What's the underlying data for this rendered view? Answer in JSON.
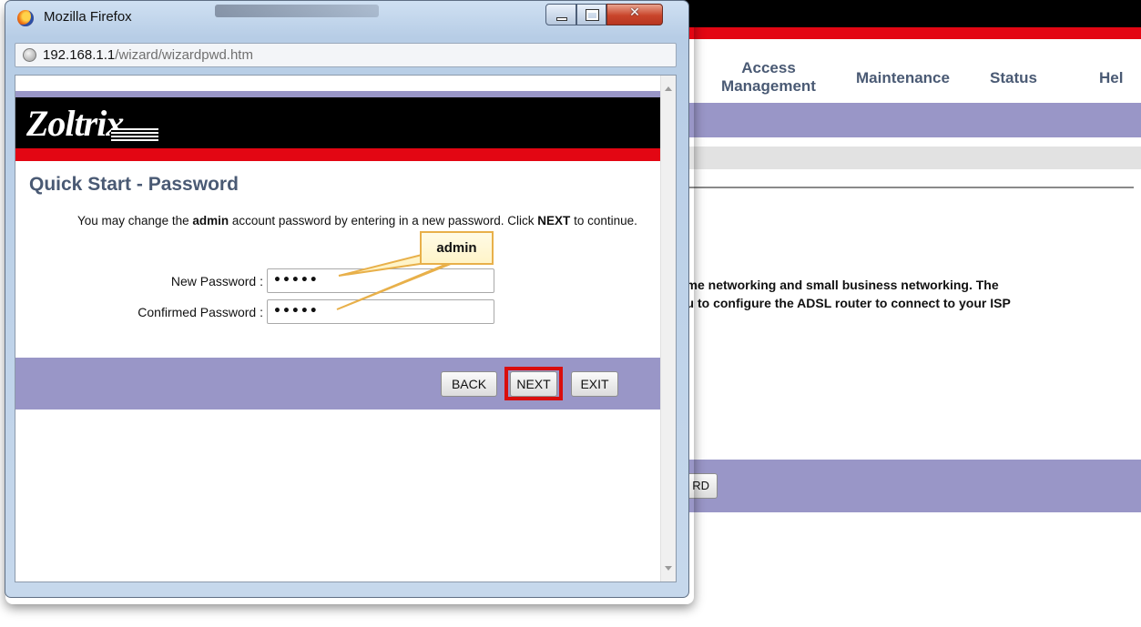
{
  "window": {
    "title": "Mozilla Firefox",
    "url_host": "192.168.1.1",
    "url_path": "/wizard/wizardpwd.htm"
  },
  "page": {
    "logo_text": "Zoltrix",
    "heading": "Quick Start - Password",
    "desc_part1": "You may change the ",
    "desc_bold1": "admin",
    "desc_part2": " account password by entering in a new password. Click ",
    "desc_bold2": "NEXT",
    "desc_part3": " to continue.",
    "new_password_label": "New Password :",
    "new_password_value": "•••••",
    "confirm_password_label": "Confirmed Password :",
    "confirm_password_value": "•••••",
    "buttons": {
      "back": "BACK",
      "next": "NEXT",
      "exit": "EXIT"
    }
  },
  "annotation": {
    "callout_text": "admin"
  },
  "background": {
    "nav_items": [
      "Access Management",
      "Maintenance",
      "Status",
      "Hel"
    ],
    "text_line1": "ome networking and small business networking. The",
    "text_line2": "ou to configure the ADSL router to connect to your ISP",
    "partial_button": "RD"
  },
  "colors": {
    "router_purple": "#9996c7",
    "router_red": "#e30613",
    "heading_slate": "#4a5a74",
    "highlight_red": "#d90d0d",
    "callout_border": "#e8b04a"
  }
}
